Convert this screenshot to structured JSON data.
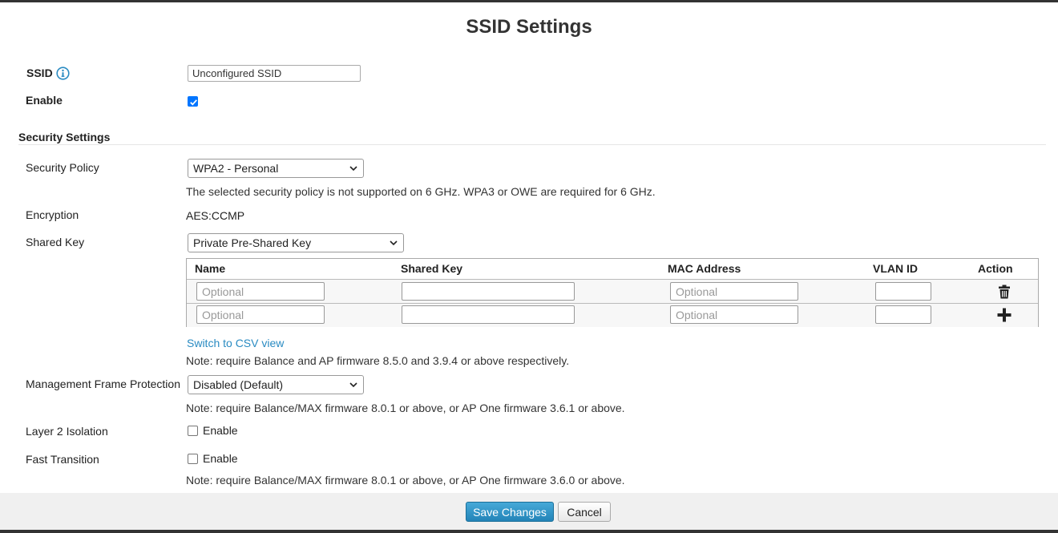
{
  "title": "SSID Settings",
  "ssid": {
    "label": "SSID",
    "value": "Unconfigured SSID",
    "info_icon": "info-icon"
  },
  "enable": {
    "label": "Enable",
    "checked": true
  },
  "security": {
    "section_title": "Security Settings",
    "policy_label": "Security Policy",
    "policy_value": "WPA2 - Personal",
    "policy_note": "The selected security policy is not supported on 6 GHz. WPA3 or OWE are required for 6 GHz.",
    "encryption_label": "Encryption",
    "encryption_value": "AES:CCMP",
    "shared_key_label": "Shared Key",
    "shared_key_value": "Private Pre-Shared Key"
  },
  "psk_table": {
    "columns": [
      "Name",
      "Shared Key",
      "MAC Address",
      "VLAN ID",
      "Action"
    ],
    "rows": [
      {
        "name_placeholder": "Optional",
        "key": "",
        "mac_placeholder": "Optional",
        "vlan": "",
        "action_icon": "trash-icon"
      },
      {
        "name_placeholder": "Optional",
        "key": "",
        "mac_placeholder": "Optional",
        "vlan": "",
        "action_icon": "plus-icon"
      }
    ],
    "csv_link": "Switch to CSV view",
    "firmware_note": "Note: require Balance and AP firmware 8.5.0 and 3.9.4 or above respectively."
  },
  "mfp": {
    "label": "Management Frame Protection",
    "value": "Disabled (Default)",
    "note": "Note: require Balance/MAX firmware 8.0.1 or above, or AP One firmware 3.6.1 or above."
  },
  "layer2": {
    "label": "Layer 2 Isolation",
    "option": "Enable",
    "checked": false
  },
  "fast_transition": {
    "label": "Fast Transition",
    "option": "Enable",
    "checked": false,
    "note": "Note: require Balance/MAX firmware 8.0.1 or above, or AP One firmware 3.6.0 or above."
  },
  "footer": {
    "save_label": "Save Changes",
    "cancel_label": "Cancel"
  },
  "colors": {
    "link": "#2a8bc2",
    "primary_button": "#2384b8",
    "checkbox_checked": "#0075ff"
  }
}
